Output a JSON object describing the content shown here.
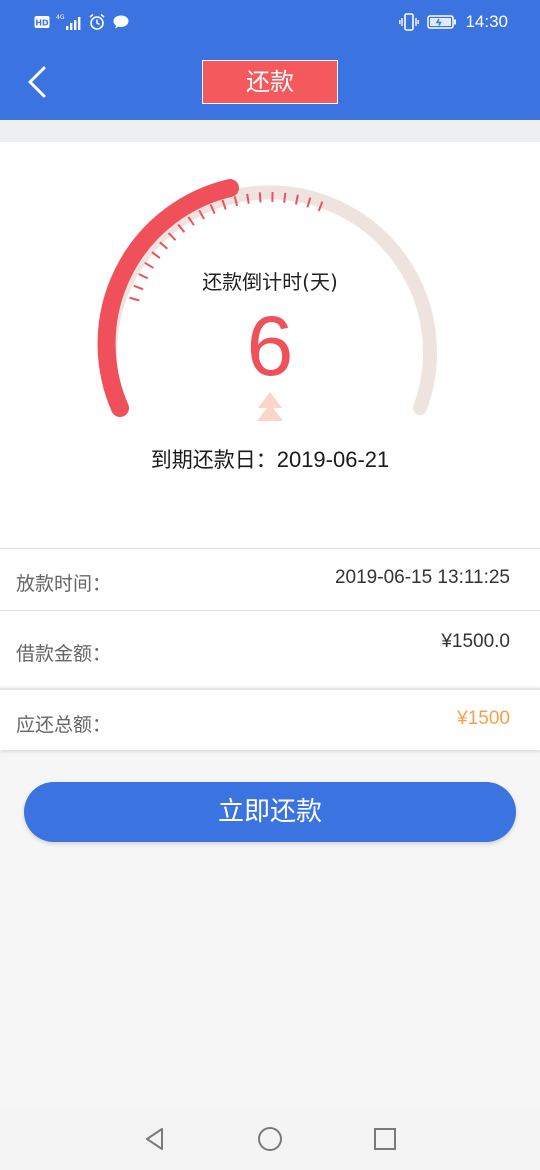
{
  "status_bar": {
    "hd_label": "HD",
    "network_label": "4G",
    "time": "14:30",
    "icons": [
      "hd-icon",
      "signal-icon",
      "alarm-icon",
      "message-icon",
      "vibrate-icon",
      "battery-icon"
    ]
  },
  "header": {
    "title": "还款",
    "back_icon": "chevron-left-icon"
  },
  "countdown": {
    "label": "还款倒计时(天)",
    "days": "6",
    "due_label": "到期还款日：",
    "due_date": "2019-06-21"
  },
  "details": {
    "loan_time_label": "放款时间：",
    "loan_time_value": "2019-06-15 13:11:25",
    "amount_label": "借款金额：",
    "amount_value": "¥1500.0",
    "total_label": "应还总额：",
    "total_value": "¥1500"
  },
  "action": {
    "repay_label": "立即还款"
  },
  "colors": {
    "brand_blue": "#3b73e0",
    "accent_red": "#f0505a",
    "total_orange": "#f3a24b",
    "gauge_track": "#efe3df"
  }
}
